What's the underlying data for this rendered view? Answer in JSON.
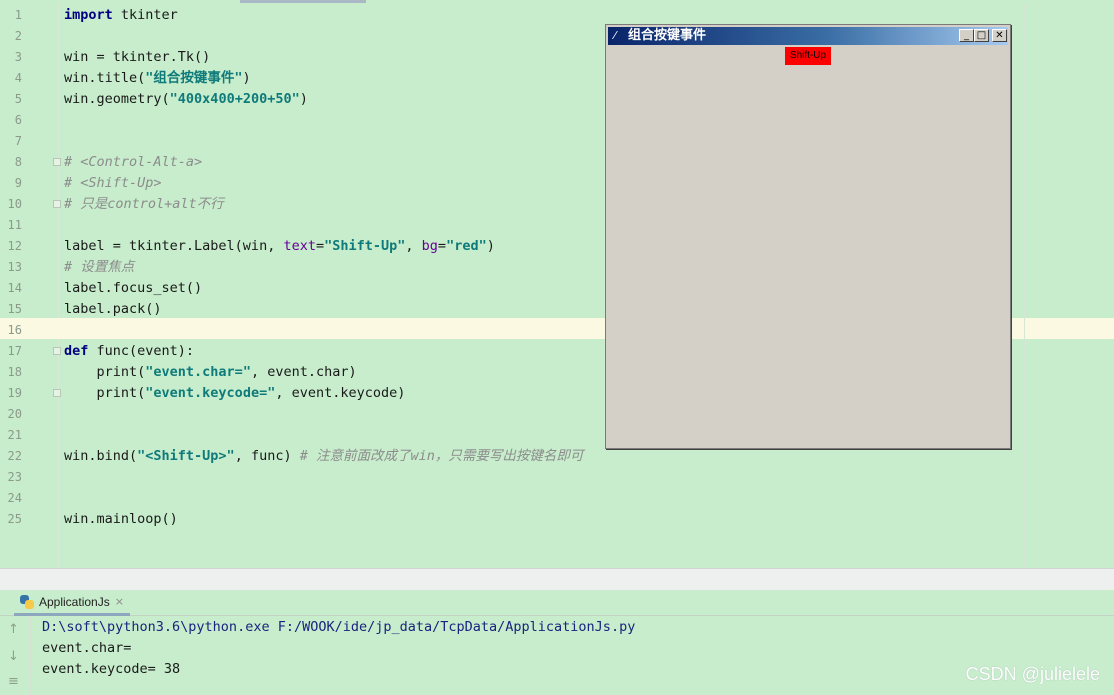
{
  "editor": {
    "lines": [
      {
        "n": "1",
        "parts": [
          {
            "c": "kw",
            "t": "import"
          },
          {
            "c": "",
            "t": " tkinter"
          }
        ]
      },
      {
        "n": "2",
        "parts": []
      },
      {
        "n": "3",
        "parts": [
          {
            "c": "",
            "t": "win = tkinter.Tk()"
          }
        ]
      },
      {
        "n": "4",
        "parts": [
          {
            "c": "",
            "t": "win.title("
          },
          {
            "c": "str2",
            "t": "\"组合按键事件\""
          },
          {
            "c": "",
            "t": ")"
          }
        ]
      },
      {
        "n": "5",
        "parts": [
          {
            "c": "",
            "t": "win.geometry("
          },
          {
            "c": "str2",
            "t": "\"400x400+200+50\""
          },
          {
            "c": "",
            "t": ")"
          }
        ]
      },
      {
        "n": "6",
        "parts": []
      },
      {
        "n": "7",
        "parts": []
      },
      {
        "n": "8",
        "parts": [
          {
            "c": "cmt",
            "t": "# <Control-Alt-a>"
          }
        ]
      },
      {
        "n": "9",
        "parts": [
          {
            "c": "cmt",
            "t": "# <Shift-Up>"
          }
        ]
      },
      {
        "n": "10",
        "parts": [
          {
            "c": "cmt",
            "t": "# 只是control+alt不行"
          }
        ]
      },
      {
        "n": "11",
        "parts": []
      },
      {
        "n": "12",
        "parts": [
          {
            "c": "",
            "t": "label = tkinter.Label(win, "
          },
          {
            "c": "param",
            "t": "text"
          },
          {
            "c": "",
            "t": "="
          },
          {
            "c": "str2",
            "t": "\"Shift-Up\""
          },
          {
            "c": "",
            "t": ", "
          },
          {
            "c": "param",
            "t": "bg"
          },
          {
            "c": "",
            "t": "="
          },
          {
            "c": "str2",
            "t": "\"red\""
          },
          {
            "c": "",
            "t": ")"
          }
        ]
      },
      {
        "n": "13",
        "parts": [
          {
            "c": "cmt",
            "t": "# 设置焦点"
          }
        ]
      },
      {
        "n": "14",
        "parts": [
          {
            "c": "",
            "t": "label.focus_set()"
          }
        ]
      },
      {
        "n": "15",
        "parts": [
          {
            "c": "",
            "t": "label.pack()"
          }
        ]
      },
      {
        "n": "16",
        "parts": []
      },
      {
        "n": "17",
        "parts": [
          {
            "c": "kw",
            "t": "def"
          },
          {
            "c": "",
            "t": " func(event):"
          }
        ]
      },
      {
        "n": "18",
        "parts": [
          {
            "c": "",
            "t": "    print("
          },
          {
            "c": "str2",
            "t": "\"event.char=\""
          },
          {
            "c": "",
            "t": ", event.char)"
          }
        ]
      },
      {
        "n": "19",
        "parts": [
          {
            "c": "",
            "t": "    print("
          },
          {
            "c": "str2",
            "t": "\"event.keycode=\""
          },
          {
            "c": "",
            "t": ", event.keycode)"
          }
        ]
      },
      {
        "n": "20",
        "parts": []
      },
      {
        "n": "21",
        "parts": []
      },
      {
        "n": "22",
        "parts": [
          {
            "c": "",
            "t": "win.bind("
          },
          {
            "c": "str2",
            "t": "\"<Shift-Up>\""
          },
          {
            "c": "",
            "t": ", func) "
          },
          {
            "c": "cmt",
            "t": "# 注意前面改成了win，只需要写出按键名即可"
          }
        ]
      },
      {
        "n": "23",
        "parts": []
      },
      {
        "n": "24",
        "parts": []
      },
      {
        "n": "25",
        "parts": [
          {
            "c": "",
            "t": "win.mainloop()"
          }
        ]
      }
    ]
  },
  "tk_window": {
    "title": "组合按键事件",
    "icon": "feather-icon",
    "minimize": "_",
    "maximize": "□",
    "close": "✕",
    "label_text": "Shift-Up",
    "label_bg": "#ff0000"
  },
  "run_panel": {
    "tab_label": "ApplicationJs",
    "tab_close": "×",
    "output": [
      "D:\\soft\\python3.6\\python.exe F:/WOOK/ide/jp_data/TcpData/ApplicationJs.py",
      "event.char= ",
      "event.keycode= 38"
    ]
  },
  "watermark": "CSDN @julielele",
  "colors": {
    "editor_bg": "#c7edcc",
    "current_line": "#fbf9e2",
    "keyword": "#000080",
    "string": "#0f7a7a",
    "comment": "#8c8c8c"
  }
}
